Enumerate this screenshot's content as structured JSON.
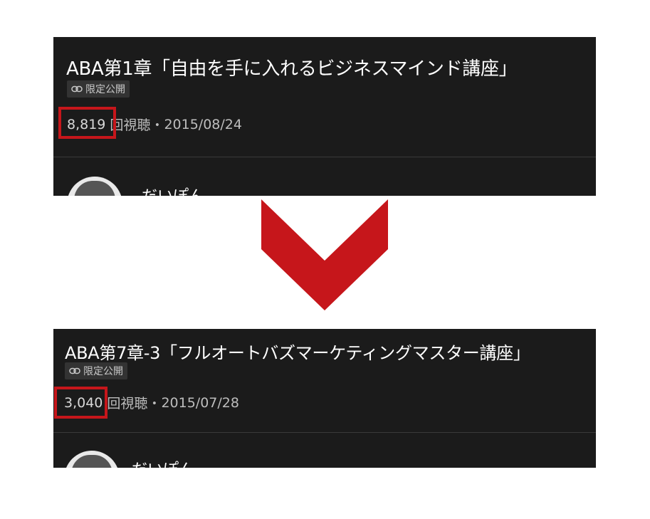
{
  "videos": [
    {
      "title": "ABA第1章「自由を手に入れるビジネスマインド講座」",
      "privacy_label": "限定公開",
      "view_count": "8,819",
      "views_suffix": "回視聴",
      "separator": "・",
      "date": "2015/08/24",
      "channel_name": "だいぽん"
    },
    {
      "title": "ABA第7章-3「フルオートバズマーケティングマスター講座」",
      "privacy_label": "限定公開",
      "view_count": "3,040",
      "views_suffix": "回視聴",
      "separator": "・",
      "date": "2015/07/28",
      "channel_name": "だいぽん"
    }
  ],
  "icons": {
    "privacy": "link-icon",
    "transition": "chevron-down-icon"
  },
  "colors": {
    "panel_bg": "#1b1b1b",
    "highlight": "#c6161b",
    "arrow": "#c6161b"
  }
}
